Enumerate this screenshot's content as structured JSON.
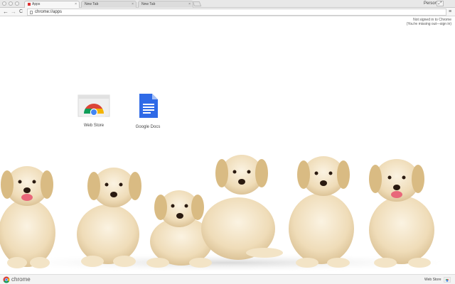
{
  "tabs": [
    {
      "label": "Apps",
      "active": true
    },
    {
      "label": "New Tab",
      "active": false
    },
    {
      "label": "New Tab",
      "active": false
    }
  ],
  "profile": {
    "label": "Person 2"
  },
  "toolbar": {
    "back": "←",
    "forward": "→",
    "reload": "C",
    "url": "chrome://apps",
    "star": "☆",
    "menu": "≡"
  },
  "signin": {
    "line1": "Not signed in to Chrome",
    "line2": "(You're missing out—sign in)"
  },
  "apps": [
    {
      "label": "Web Store",
      "icon": "web-store-icon"
    },
    {
      "label": "Google Docs",
      "icon": "google-docs-icon"
    }
  ],
  "bottom": {
    "brand": "chrome",
    "webstore": "Web Store"
  },
  "colors": {
    "chrome_red": "#db4437",
    "chrome_green": "#0f9d58",
    "chrome_yellow": "#f4b400",
    "chrome_blue": "#4285f4",
    "docs_blue": "#2f6ae7"
  }
}
